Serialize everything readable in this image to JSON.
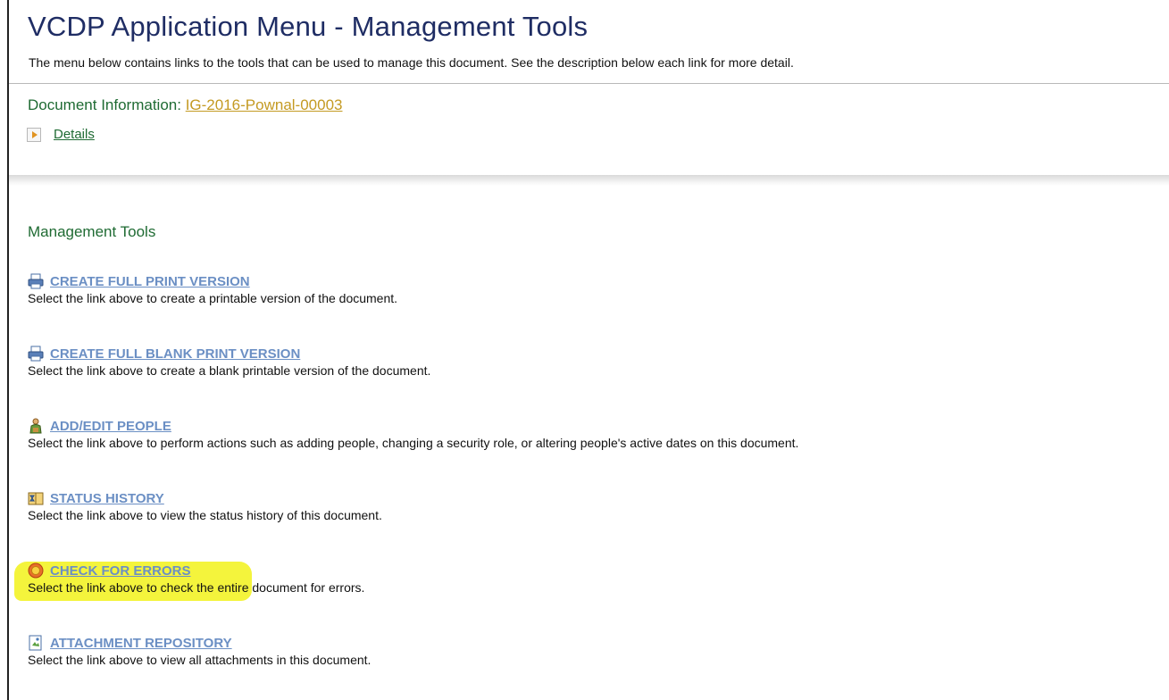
{
  "header": {
    "title": "VCDP Application Menu - Management Tools",
    "subtitle": "The menu below contains links to the tools that can be used to manage this document. See the description below each link for more detail."
  },
  "document": {
    "label": "Document Information: ",
    "id": "IG-2016-Pownal-00003",
    "details_label": "Details"
  },
  "section": {
    "title": "Management Tools"
  },
  "tools": [
    {
      "label": "CREATE FULL PRINT VERSION",
      "description": "Select the link above to create a printable version of the document.",
      "icon": "printer-icon"
    },
    {
      "label": "CREATE FULL BLANK PRINT VERSION",
      "description": "Select the link above to create a blank printable version of the document.",
      "icon": "printer-icon"
    },
    {
      "label": "ADD/EDIT PEOPLE",
      "description": "Select the link above to perform actions such as adding people, changing a security role, or altering people's active dates on this document.",
      "icon": "people-icon"
    },
    {
      "label": "STATUS HISTORY",
      "description": "Select the link above to view the status history of this document.",
      "icon": "history-icon"
    },
    {
      "label": "CHECK FOR ERRORS",
      "description": "Select the link above to check the entire document for errors.",
      "icon": "error-check-icon"
    },
    {
      "label": "ATTACHMENT REPOSITORY",
      "description": "Select the link above to view all attachments in this document.",
      "icon": "attachment-icon"
    }
  ],
  "colors": {
    "title": "#1f2d64",
    "green": "#1f6b33",
    "doc_link": "#c49a22",
    "tool_link": "#6b8fc4",
    "highlight": "#f4f43c"
  }
}
